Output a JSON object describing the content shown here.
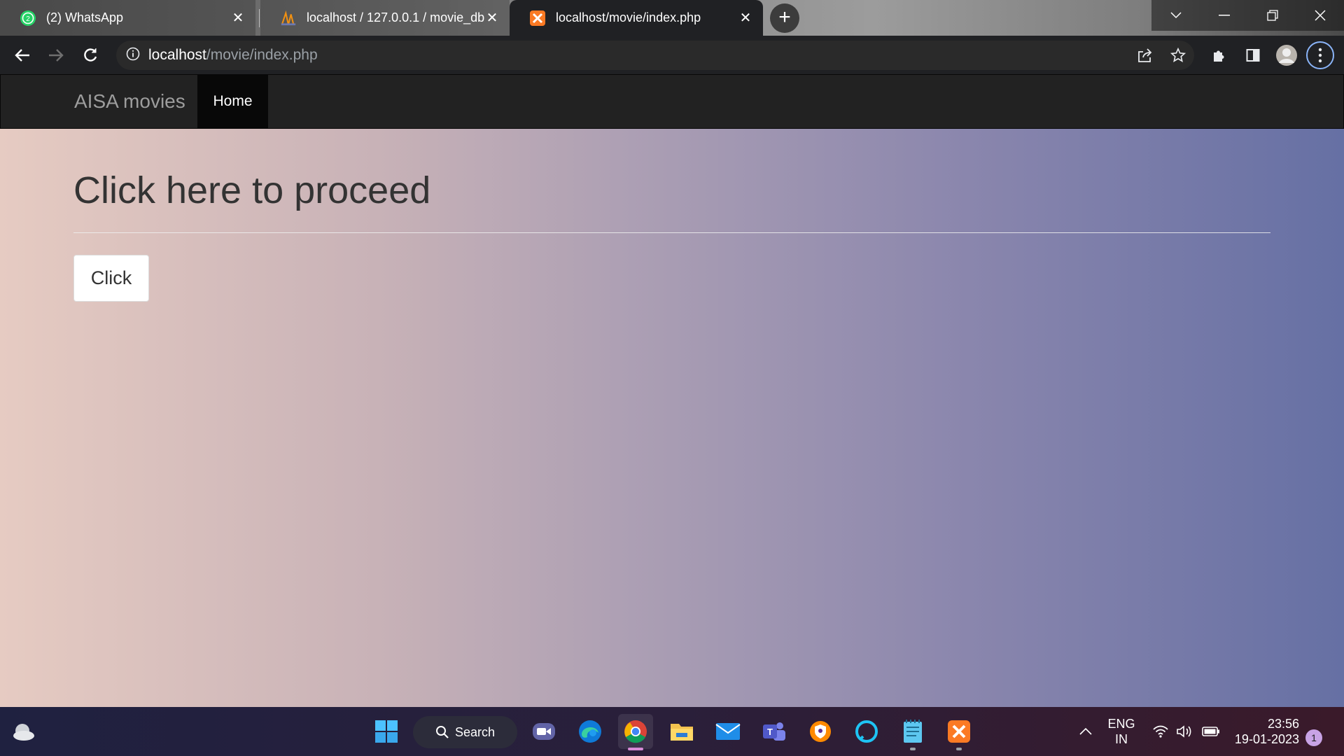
{
  "browser": {
    "tabs": [
      {
        "title": "(2) WhatsApp",
        "badge": "2",
        "icon": "whatsapp-icon"
      },
      {
        "title": "localhost / 127.0.0.1 / movie_db",
        "icon": "phpmyadmin-icon"
      },
      {
        "title": "localhost/movie/index.php",
        "icon": "xampp-icon",
        "active": true
      }
    ],
    "address": {
      "host": "localhost",
      "path": "/movie/index.php"
    }
  },
  "site": {
    "brand": "AISA movies",
    "nav": {
      "home": "Home"
    },
    "heading": "Click here to proceed",
    "button_label": "Click"
  },
  "taskbar": {
    "search_label": "Search",
    "language_top": "ENG",
    "language_bottom": "IN",
    "time": "23:56",
    "date": "19-01-2023",
    "notification_count": "1"
  },
  "colors": {
    "navbar": "#222222",
    "nav_active": "#080808",
    "gradient_start": "#e6cbc2",
    "gradient_end": "#6670a4",
    "chrome_dark": "#202124"
  }
}
